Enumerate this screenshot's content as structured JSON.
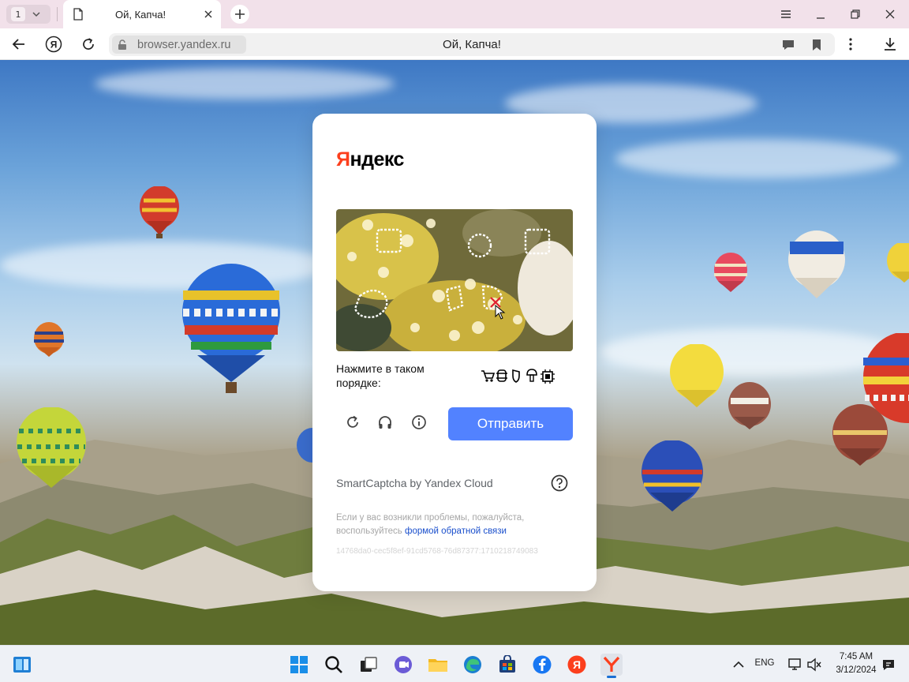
{
  "browser": {
    "tab_count": "1",
    "tab_title": "Ой, Капча!",
    "domain": "browser.yandex.ru",
    "page_title": "Ой, Капча!"
  },
  "captcha": {
    "logo_first": "Я",
    "logo_rest": "ндекс",
    "instruction": "Нажмите в таком порядке:",
    "order_icons": [
      "cart-icon",
      "bug-icon",
      "shield-icon",
      "mushroom-icon",
      "chip-icon"
    ],
    "submit_label": "Отправить",
    "brand": "SmartCaptcha by Yandex Cloud",
    "feedback_text": "Если у вас возникли проблемы, пожалуйста, воспользуйтесь ",
    "feedback_link": "формой обратной связи",
    "captcha_id": "14768da0-cec5f8ef-91cd5768-76d87377:1710218749083"
  },
  "taskbar": {
    "language": "ENG",
    "time": "7:45 AM",
    "date": "3/12/2024"
  },
  "colors": {
    "accent": "#5282ff",
    "brand_red": "#fc3f1d",
    "link": "#1a4fcc"
  }
}
